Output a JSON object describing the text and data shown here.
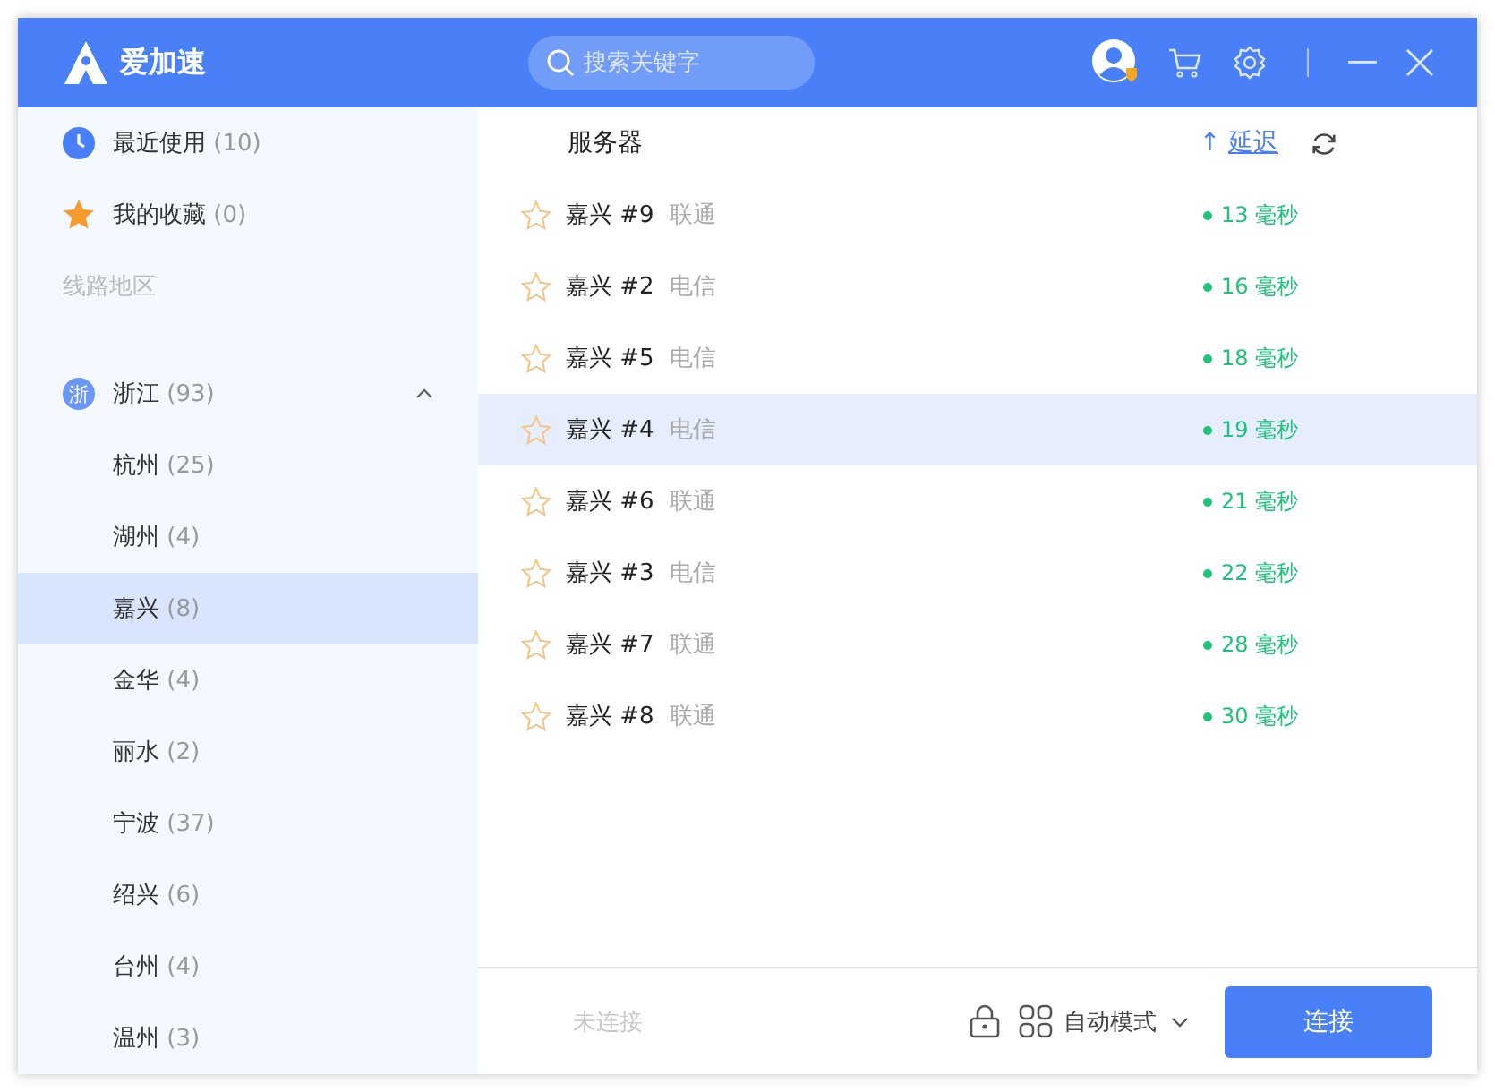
{
  "app": {
    "name": "爱加速"
  },
  "search": {
    "placeholder": "搜索关键字"
  },
  "sidebar": {
    "shortcuts": [
      {
        "kind": "recent",
        "label": "最近使用",
        "count": "(10)"
      },
      {
        "kind": "favorites",
        "label": "我的收藏",
        "count": "(0)"
      }
    ],
    "section_title": "线路地区",
    "regions": [
      {
        "badge": "浙",
        "name": "浙江",
        "count": "(93)",
        "expanded": true,
        "children": [
          {
            "name": "杭州",
            "count": "(25)",
            "selected": false
          },
          {
            "name": "湖州",
            "count": "(4)",
            "selected": false
          },
          {
            "name": "嘉兴",
            "count": "(8)",
            "selected": true
          },
          {
            "name": "金华",
            "count": "(4)",
            "selected": false
          },
          {
            "name": "丽水",
            "count": "(2)",
            "selected": false
          },
          {
            "name": "宁波",
            "count": "(37)",
            "selected": false
          },
          {
            "name": "绍兴",
            "count": "(6)",
            "selected": false
          },
          {
            "name": "台州",
            "count": "(4)",
            "selected": false
          },
          {
            "name": "温州",
            "count": "(3)",
            "selected": false
          }
        ]
      }
    ]
  },
  "servers": {
    "columns": {
      "name": "服务器",
      "sort_arrow": "↑",
      "latency": "延迟"
    },
    "rows": [
      {
        "name": "嘉兴 #9",
        "carrier": "联通",
        "latency": "13 毫秒",
        "favorite": false,
        "selected": false
      },
      {
        "name": "嘉兴 #2",
        "carrier": "电信",
        "latency": "16 毫秒",
        "favorite": false,
        "selected": false
      },
      {
        "name": "嘉兴 #5",
        "carrier": "电信",
        "latency": "18 毫秒",
        "favorite": false,
        "selected": false
      },
      {
        "name": "嘉兴 #4",
        "carrier": "电信",
        "latency": "19 毫秒",
        "favorite": false,
        "selected": true
      },
      {
        "name": "嘉兴 #6",
        "carrier": "联通",
        "latency": "21 毫秒",
        "favorite": false,
        "selected": false
      },
      {
        "name": "嘉兴 #3",
        "carrier": "电信",
        "latency": "22 毫秒",
        "favorite": false,
        "selected": false
      },
      {
        "name": "嘉兴 #7",
        "carrier": "联通",
        "latency": "28 毫秒",
        "favorite": false,
        "selected": false
      },
      {
        "name": "嘉兴 #8",
        "carrier": "联通",
        "latency": "30 毫秒",
        "favorite": false,
        "selected": false
      }
    ]
  },
  "footer": {
    "status": "未连接",
    "mode": "自动模式",
    "connect_button": "连接"
  }
}
